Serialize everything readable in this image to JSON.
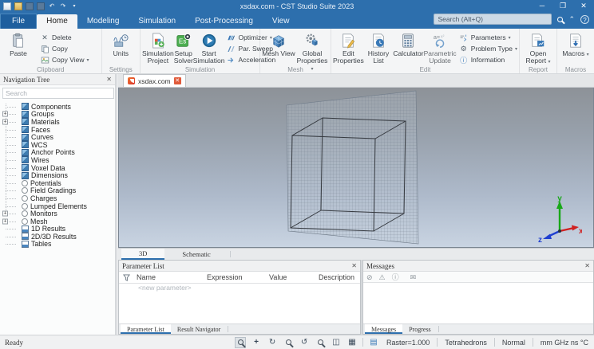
{
  "window": {
    "title": "xsdax.com - CST Studio Suite 2023",
    "search_placeholder": "Search (Alt+Q)"
  },
  "menu_tabs": [
    {
      "label": "File"
    },
    {
      "label": "Home"
    },
    {
      "label": "Modeling"
    },
    {
      "label": "Simulation"
    },
    {
      "label": "Post-Processing"
    },
    {
      "label": "View"
    }
  ],
  "ribbon": {
    "clipboard": {
      "label": "Clipboard",
      "paste": "Paste",
      "delete": "Delete",
      "copy": "Copy",
      "copy_view": "Copy View"
    },
    "settings": {
      "label": "Settings",
      "units": "Units"
    },
    "simulation": {
      "label": "Simulation",
      "simulation_project": "Simulation Project",
      "setup_solver": "Setup Solver",
      "start_simulation": "Start Simulation",
      "optimizer": "Optimizer",
      "par_sweep": "Par. Sweep",
      "acceleration": "Acceleration"
    },
    "mesh": {
      "label": "Mesh",
      "mesh_view": "Mesh View",
      "global_properties": "Global Properties"
    },
    "edit": {
      "label": "Edit",
      "edit_properties": "Edit Properties",
      "history_list": "History List",
      "calculator": "Calculator",
      "parametric_update": "Parametric Update",
      "parameters": "Parameters",
      "problem_type": "Problem Type",
      "information": "Information"
    },
    "report": {
      "label": "Report",
      "open_report": "Open Report"
    },
    "macros": {
      "label": "Macros",
      "macros_btn": "Macros"
    }
  },
  "nav_tree": {
    "title": "Navigation Tree",
    "search_placeholder": "Search",
    "items": [
      {
        "label": "Components",
        "icon": "cube"
      },
      {
        "label": "Groups",
        "icon": "cube",
        "expandable": true
      },
      {
        "label": "Materials",
        "icon": "cube",
        "expandable": true
      },
      {
        "label": "Faces",
        "icon": "cube"
      },
      {
        "label": "Curves",
        "icon": "cube"
      },
      {
        "label": "WCS",
        "icon": "cube"
      },
      {
        "label": "Anchor Points",
        "icon": "cube"
      },
      {
        "label": "Wires",
        "icon": "cube"
      },
      {
        "label": "Voxel Data",
        "icon": "cube"
      },
      {
        "label": "Dimensions",
        "icon": "cube"
      },
      {
        "label": "Potentials",
        "icon": "ring"
      },
      {
        "label": "Field Gradings",
        "icon": "ring"
      },
      {
        "label": "Charges",
        "icon": "ring"
      },
      {
        "label": "Lumped Elements",
        "icon": "ring"
      },
      {
        "label": "Monitors",
        "icon": "ring",
        "expandable": true
      },
      {
        "label": "Mesh",
        "icon": "ring",
        "expandable": true
      },
      {
        "label": "1D Results",
        "icon": "chart"
      },
      {
        "label": "2D/3D Results",
        "icon": "chart"
      },
      {
        "label": "Tables",
        "icon": "chart"
      }
    ]
  },
  "document_tab": {
    "label": "xsdax.com"
  },
  "view_tabs": [
    {
      "label": "3D"
    },
    {
      "label": "Schematic"
    }
  ],
  "parameter_list": {
    "title": "Parameter List",
    "columns": [
      "Name",
      "Expression",
      "Value",
      "Description"
    ],
    "placeholder_row": "<new parameter>",
    "tabs": [
      "Parameter List",
      "Result Navigator"
    ]
  },
  "messages": {
    "title": "Messages",
    "tabs": [
      "Messages",
      "Progress"
    ]
  },
  "status_bar": {
    "ready": "Ready",
    "raster": "Raster=1.000",
    "mesh_type": "Tetrahedrons",
    "view_mode": "Normal",
    "units": "mm GHz ns °C"
  },
  "axes": {
    "x": "x",
    "y": "y",
    "z": "z"
  },
  "colors": {
    "titlebar": "#2d6fad",
    "accent": "#2d6fad",
    "viewport_top": "#8d9298",
    "viewport_bottom": "#c9d4e2",
    "axis_x": "#d02020",
    "axis_y": "#18a818",
    "axis_z": "#2040d0"
  }
}
